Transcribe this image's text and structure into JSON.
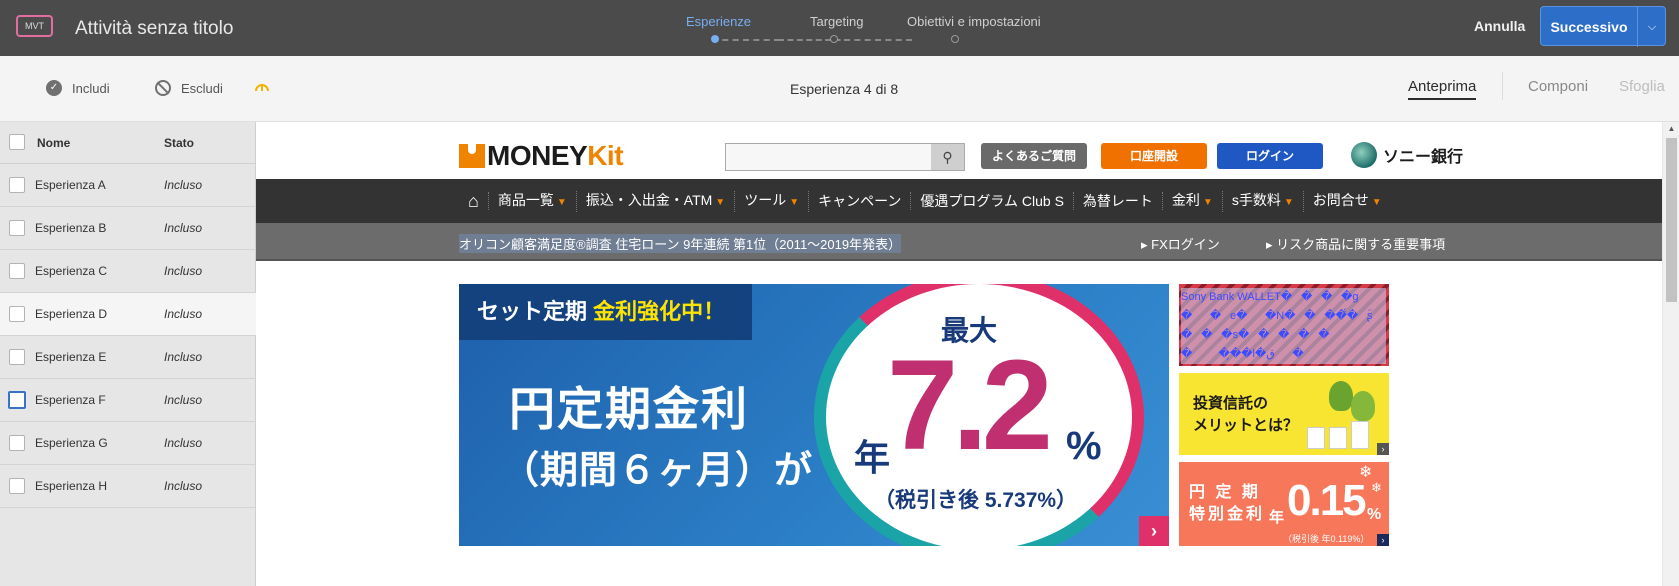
{
  "topbar": {
    "badge": "MVT",
    "activity_title": "Attività senza titolo",
    "steps": [
      {
        "label": "Esperienze",
        "active": true
      },
      {
        "label": "Targeting",
        "active": false
      },
      {
        "label": "Obiettivi e impostazioni",
        "active": false
      }
    ],
    "cancel_label": "Annulla",
    "next_label": "Successivo",
    "next_icon": "chevron-down-icon",
    "accent_color": "#2d6ec8"
  },
  "subbar": {
    "include_label": "Includi",
    "exclude_label": "Escludi",
    "experience_counter": "Esperienza 4 di 8",
    "tabs": [
      {
        "label": "Anteprima",
        "state": "active"
      },
      {
        "label": "Componi",
        "state": "normal"
      },
      {
        "label": "Sfoglia",
        "state": "disabled"
      }
    ]
  },
  "sidebar": {
    "col_name": "Nome",
    "col_status": "Stato",
    "rows": [
      {
        "name": "Esperienza A",
        "status": "Incluso"
      },
      {
        "name": "Esperienza B",
        "status": "Incluso"
      },
      {
        "name": "Esperienza C",
        "status": "Incluso"
      },
      {
        "name": "Esperienza D",
        "status": "Incluso"
      },
      {
        "name": "Esperienza E",
        "status": "Incluso"
      },
      {
        "name": "Esperienza F",
        "status": "Incluso"
      },
      {
        "name": "Esperienza G",
        "status": "Incluso"
      },
      {
        "name": "Esperienza H",
        "status": "Incluso"
      }
    ]
  },
  "site": {
    "logo_prefix": "MONEY",
    "logo_suffix": "Kit",
    "faq_btn": "よくあるご質問",
    "open_account_btn": "口座開設",
    "login_btn": "ログイン",
    "bank_name": "ソニー銀行",
    "nav": [
      "商品一覧",
      "振込・入出金・ATM",
      "ツール",
      "キャンペーン",
      "優遇プログラム Club S",
      "為替レート",
      "金利",
      "s手数料",
      "お問合せ"
    ],
    "info_left": "オリコン顧客満足度®調査 住宅ローン 9年連続 第1位（2011～2019年発表）",
    "info_links": [
      "FXログイン",
      "リスク商品に関する重要事項"
    ],
    "banner": {
      "tag_prefix": "セット定期",
      "tag_highlight": "金利強化中！",
      "main": "円定期金利",
      "sub": "（期間６ヶ月）が",
      "max": "最大",
      "nen": "年",
      "rate": "7.2",
      "pct": "%",
      "after_tax": "（税引き後 5.737%）"
    },
    "ad1_text": "Sony Bank WALLET����g��e��N����̈́�ʂ̈���s�������̗��l�ق�",
    "ad2_text_line1": "投資信託の",
    "ad2_text_line2": "メリットとは？",
    "ad3": {
      "line1": "円 定 期",
      "line2": "特別金利",
      "nen": "年",
      "rate": "0.15",
      "pct": "%",
      "after": "（税引後 年0.119%）"
    }
  }
}
